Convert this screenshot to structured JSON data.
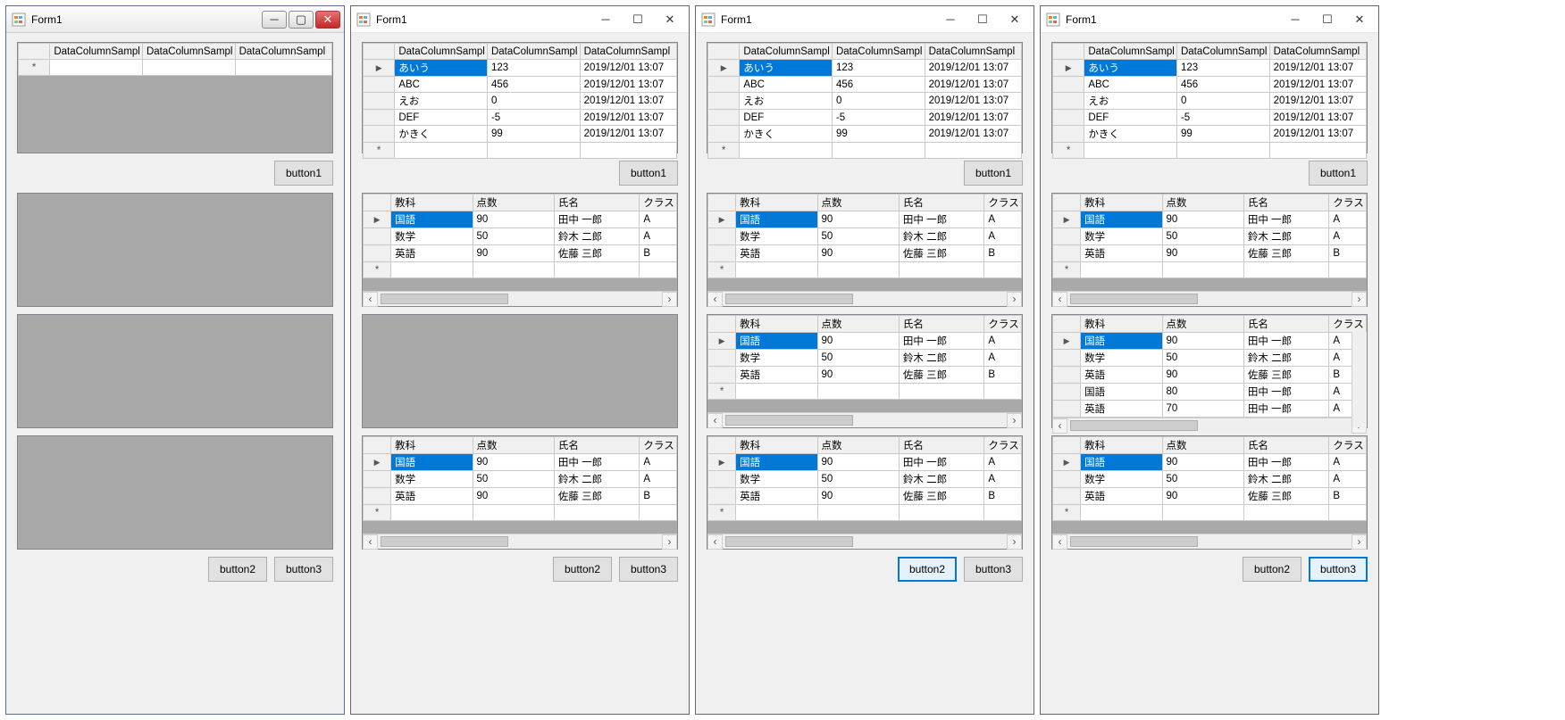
{
  "form_title": "Form1",
  "grid1": {
    "columns": [
      "DataColumnSampl",
      "DataColumnSampl",
      "DataColumnSampl"
    ],
    "rows": [
      {
        "c0": "あいう",
        "c1": "123",
        "c2": "2019/12/01 13:07",
        "selected": true
      },
      {
        "c0": "ABC",
        "c1": "456",
        "c2": "2019/12/01 13:07"
      },
      {
        "c0": "えお",
        "c1": "0",
        "c2": "2019/12/01 13:07"
      },
      {
        "c0": "DEF",
        "c1": "-5",
        "c2": "2019/12/01 13:07"
      },
      {
        "c0": "かきく",
        "c1": "99",
        "c2": "2019/12/01 13:07"
      }
    ]
  },
  "grid2": {
    "columns": [
      "教科",
      "点数",
      "氏名",
      "クラス名"
    ],
    "col3_clipped": "クラス",
    "rows3": [
      {
        "c0": "国語",
        "c1": "90",
        "c2": "田中 一郎",
        "c3": "A",
        "selected": true
      },
      {
        "c0": "数学",
        "c1": "50",
        "c2": "鈴木 二郎",
        "c3": "A"
      },
      {
        "c0": "英語",
        "c1": "90",
        "c2": "佐藤 三郎",
        "c3": "B"
      }
    ],
    "rows_many": [
      {
        "c0": "国語",
        "c1": "90",
        "c2": "田中 一郎",
        "c3": "A",
        "selected": true
      },
      {
        "c0": "数学",
        "c1": "50",
        "c2": "鈴木 二郎",
        "c3": "A"
      },
      {
        "c0": "英語",
        "c1": "90",
        "c2": "佐藤 三郎",
        "c3": "B"
      },
      {
        "c0": "国語",
        "c1": "80",
        "c2": "田中 一郎",
        "c3": "A"
      },
      {
        "c0": "英語",
        "c1": "70",
        "c2": "田中 一郎",
        "c3": "A"
      }
    ]
  },
  "buttons": {
    "b1": "button1",
    "b2": "button2",
    "b3": "button3"
  }
}
